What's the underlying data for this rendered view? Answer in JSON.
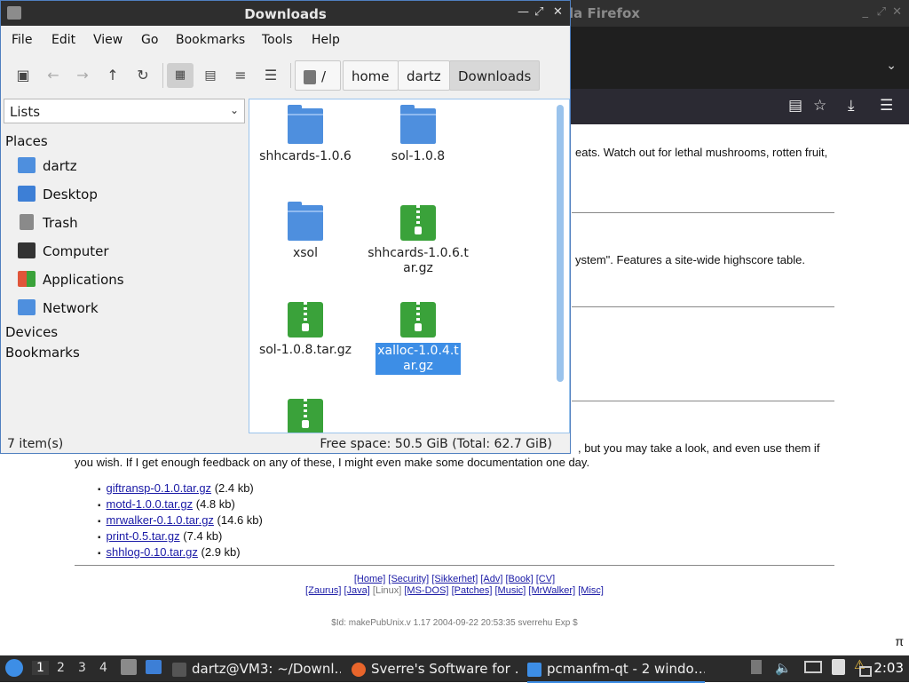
{
  "firefox": {
    "title_fragment": "la Firefox",
    "window_controls": [
      "_",
      "⤢",
      "✕"
    ],
    "nav_icons": [
      "reader-view-icon",
      "star-icon",
      "download-icon",
      "menu-icon"
    ],
    "content": {
      "line1": "eats. Watch out for lethal mushrooms, rotten fruit,",
      "line2": "ystem\". Features a site-wide highscore table.",
      "line3": ", but you may take a look, and even use them if",
      "line4": "you wish. If I get enough feedback on any of these, I might even make some documentation one day.",
      "downloads": [
        {
          "name": "giftransp-0.1.0.tar.gz",
          "size": "(2.4 kb)"
        },
        {
          "name": "motd-1.0.0.tar.gz",
          "size": "(4.8 kb)"
        },
        {
          "name": "mrwalker-0.1.0.tar.gz",
          "size": "(14.6 kb)"
        },
        {
          "name": "print-0.5.tar.gz",
          "size": "(7.4 kb)"
        },
        {
          "name": "shhlog-0.10.tar.gz",
          "size": "(2.9 kb)"
        }
      ],
      "footer_nav1": [
        "[Home]",
        "[Security]",
        "[Sikkerhet]",
        "[Adv]",
        "[Book]",
        "[CV]"
      ],
      "footer_nav2": [
        "[Zaurus]",
        "[Java]",
        "[Linux]",
        "[MS-DOS]",
        "[Patches]",
        "[Music]",
        "[MrWalker]",
        "[Misc]"
      ],
      "footer_id": "$Id: makePubUnix.v 1.17 2004-09-22 20:53:35 sverrehu Exp $",
      "pi": "π"
    }
  },
  "filemanager": {
    "title": "Downloads",
    "menu": [
      "File",
      "Edit",
      "View",
      "Go",
      "Bookmarks",
      "Tools",
      "Help"
    ],
    "toolbar": [
      "new-tab-icon",
      "back-icon",
      "forward-icon",
      "up-icon",
      "reload-icon",
      "icon-view-icon",
      "thumbnail-view-icon",
      "compact-view-icon",
      "detailed-view-icon"
    ],
    "breadcrumb": [
      "/",
      "home",
      "dartz",
      "Downloads"
    ],
    "side_pane_mode": "Lists",
    "sections": {
      "places": "Places",
      "devices": "Devices",
      "bookmarks": "Bookmarks"
    },
    "places": [
      {
        "label": "dartz",
        "icon": "home-folder-icon",
        "color": "#4e8fde"
      },
      {
        "label": "Desktop",
        "icon": "desktop-icon",
        "color": "#3d7fd6"
      },
      {
        "label": "Trash",
        "icon": "trash-icon",
        "color": "#8a8a8a"
      },
      {
        "label": "Computer",
        "icon": "computer-icon",
        "color": "#333333"
      },
      {
        "label": "Applications",
        "icon": "applications-icon",
        "color": "#e0553a"
      },
      {
        "label": "Network",
        "icon": "network-icon",
        "color": "#4e8fde"
      }
    ],
    "files": [
      {
        "name": "shhcards-1.0.6",
        "type": "folder"
      },
      {
        "name": "sol-1.0.8",
        "type": "folder"
      },
      {
        "name": "xsol",
        "type": "folder"
      },
      {
        "name": "shhcards-1.0.6.tar.gz",
        "type": "archive"
      },
      {
        "name": "sol-1.0.8.tar.gz",
        "type": "archive"
      },
      {
        "name": "xalloc-1.0.4.tar.gz",
        "type": "archive",
        "selected": true
      },
      {
        "name": "",
        "type": "archive"
      }
    ],
    "status_left": "7 item(s)",
    "status_right": "Free space: 50.5 GiB (Total: 62.7 GiB)"
  },
  "taskbar": {
    "workspaces": [
      "1",
      "2",
      "3",
      "4"
    ],
    "tasks": [
      {
        "label": "dartz@VM3: ~/Downl…",
        "icon": "terminal-icon"
      },
      {
        "label": "Sverre's Software for …",
        "icon": "firefox-icon"
      },
      {
        "label": "pcmanfm-qt - 2 windo…",
        "icon": "file-manager-icon"
      }
    ],
    "clock": "2:03",
    "accent": "#3d8ee6"
  }
}
